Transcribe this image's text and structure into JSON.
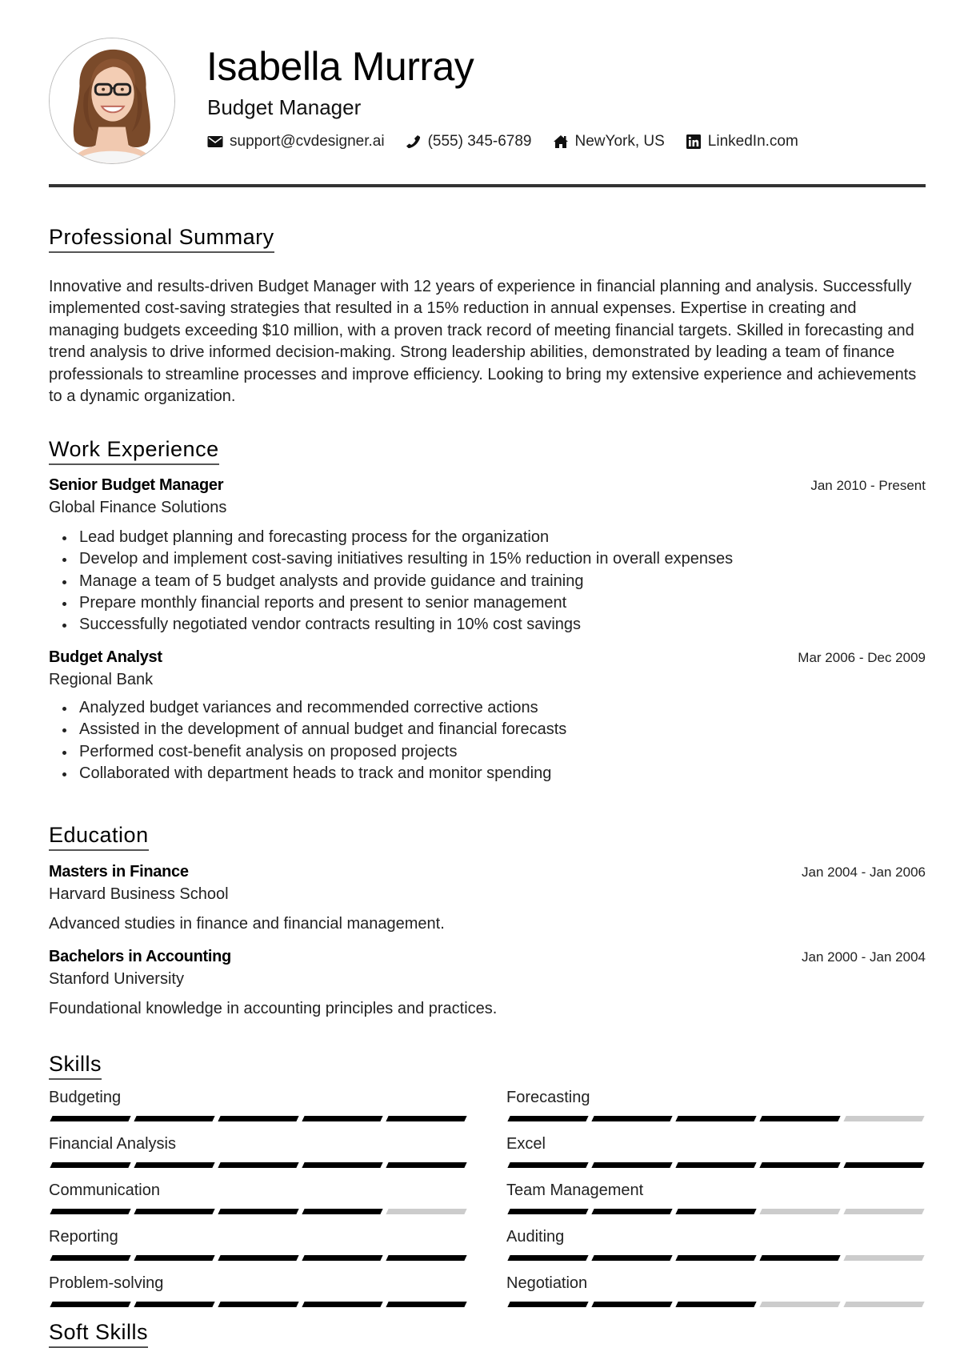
{
  "header": {
    "name": "Isabella Murray",
    "title": "Budget Manager",
    "photo_alt": "Profile photo",
    "contacts": [
      {
        "icon": "envelope-icon",
        "text": "support@cvdesigner.ai"
      },
      {
        "icon": "phone-icon",
        "text": "(555) 345-6789"
      },
      {
        "icon": "home-icon",
        "text": "NewYork, US"
      },
      {
        "icon": "linkedin-icon",
        "text": "LinkedIn.com"
      }
    ]
  },
  "summary": {
    "heading": "Professional Summary",
    "text": "Innovative and results-driven Budget Manager with 12 years of experience in financial planning and analysis. Successfully implemented cost-saving strategies that resulted in a 15% reduction in annual expenses. Expertise in creating and managing budgets exceeding $10 million, with a proven track record of meeting financial targets. Skilled in forecasting and trend analysis to drive informed decision-making. Strong leadership abilities, demonstrated by leading a team of finance professionals to streamline processes and improve efficiency. Looking to bring my extensive experience and achievements to a dynamic organization."
  },
  "experience": {
    "heading": "Work Experience",
    "jobs": [
      {
        "role": "Senior Budget Manager",
        "company": "Global Finance Solutions",
        "dates": "Jan 2010 - Present",
        "bullets": [
          "Lead budget planning and forecasting process for the organization",
          "Develop and implement cost-saving initiatives resulting in 15% reduction in overall expenses",
          "Manage a team of 5 budget analysts and provide guidance and training",
          "Prepare monthly financial reports and present to senior management",
          "Successfully negotiated vendor contracts resulting in 10% cost savings"
        ]
      },
      {
        "role": "Budget Analyst",
        "company": "Regional Bank",
        "dates": "Mar 2006 - Dec 2009",
        "bullets": [
          "Analyzed budget variances and recommended corrective actions",
          "Assisted in the development of annual budget and financial forecasts",
          "Performed cost-benefit analysis on proposed projects",
          "Collaborated with department heads to track and monitor spending"
        ]
      }
    ]
  },
  "education": {
    "heading": "Education",
    "items": [
      {
        "degree": "Masters in Finance",
        "school": "Harvard Business School",
        "dates": "Jan 2004 - Jan 2006",
        "description": "Advanced studies in finance and financial management."
      },
      {
        "degree": "Bachelors in Accounting",
        "school": "Stanford University",
        "dates": "Jan 2000 - Jan 2004",
        "description": "Foundational knowledge in accounting principles and practices."
      }
    ]
  },
  "skills": {
    "heading": "Skills",
    "max_level": 5,
    "items": [
      {
        "name": "Budgeting",
        "level": 5
      },
      {
        "name": "Forecasting",
        "level": 4
      },
      {
        "name": "Financial Analysis",
        "level": 5
      },
      {
        "name": "Excel",
        "level": 5
      },
      {
        "name": "Communication",
        "level": 4
      },
      {
        "name": "Team Management",
        "level": 3
      },
      {
        "name": "Reporting",
        "level": 5
      },
      {
        "name": "Auditing",
        "level": 4
      },
      {
        "name": "Problem-solving",
        "level": 5
      },
      {
        "name": "Negotiation",
        "level": 3
      }
    ]
  },
  "soft_skills": {
    "heading": "Soft Skills"
  },
  "colors": {
    "text": "#222222",
    "heading": "#000000",
    "divider": "#333333",
    "skill_on": "#000000",
    "skill_off": "#cccccc"
  }
}
